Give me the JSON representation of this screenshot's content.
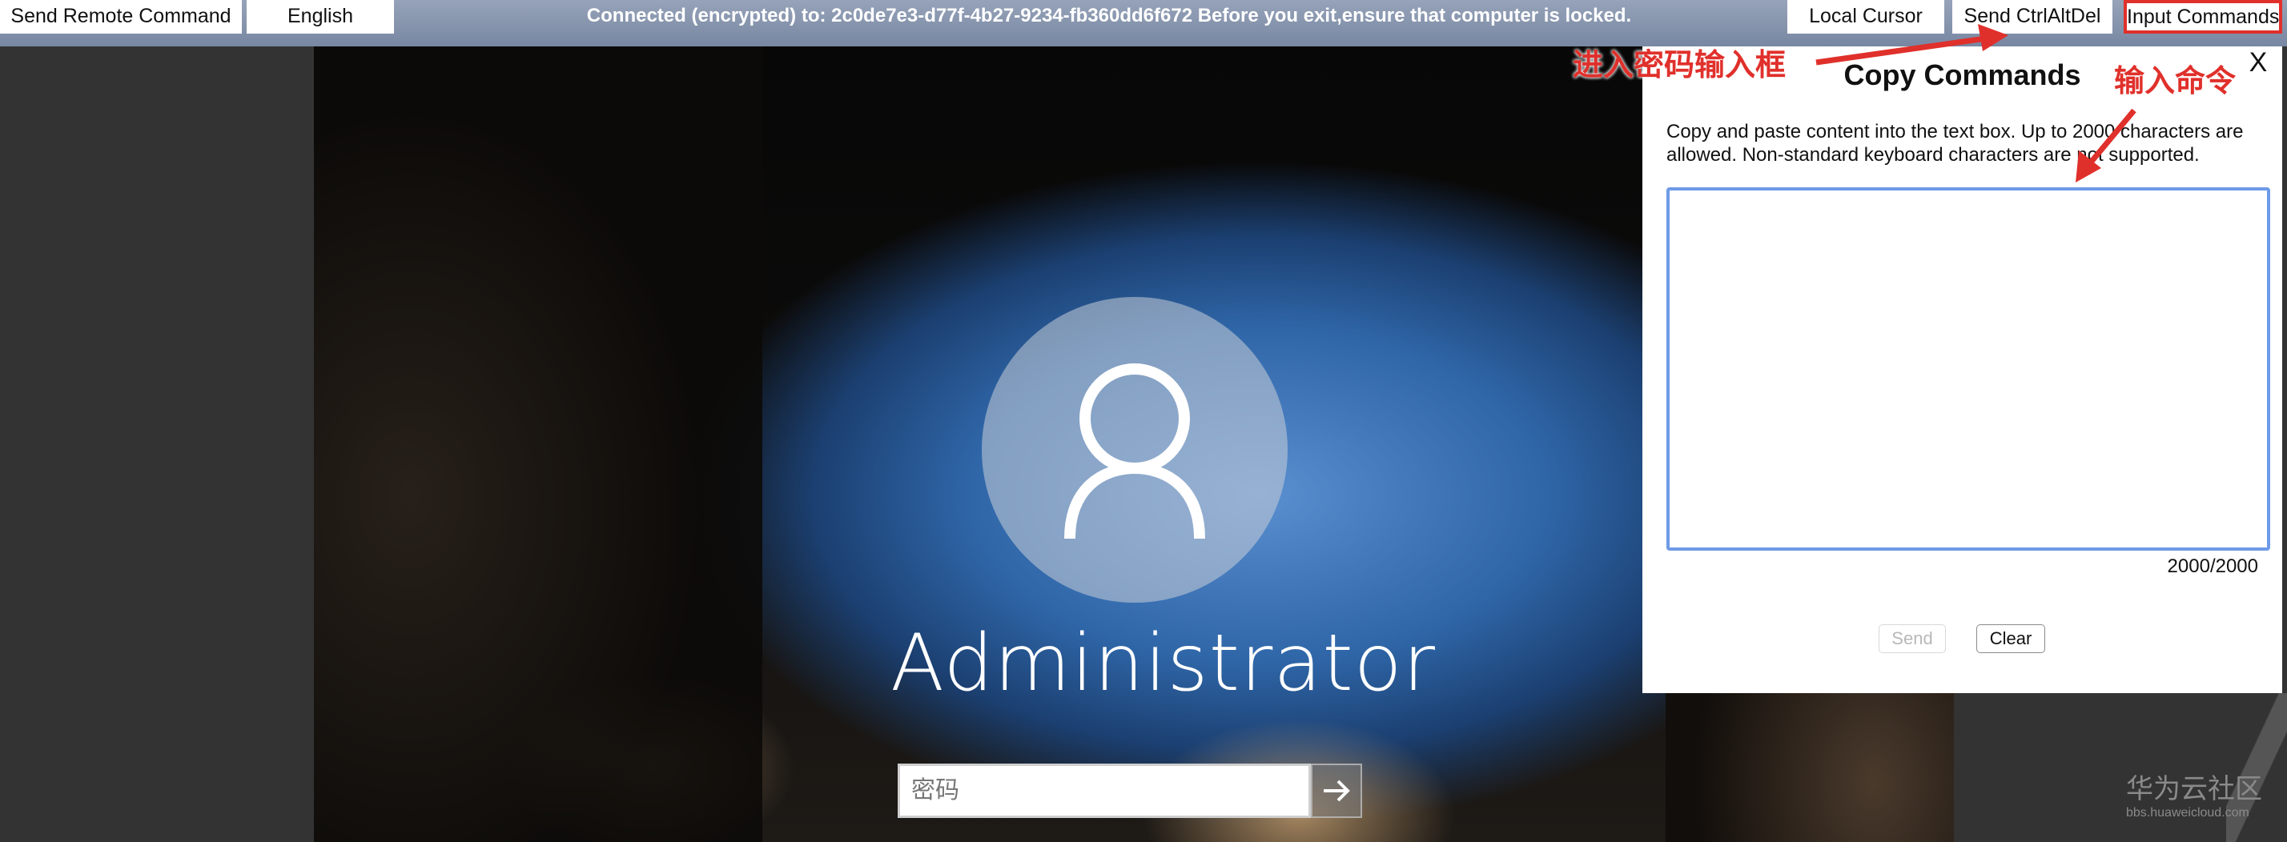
{
  "toolbar": {
    "send_remote_command": "Send Remote Command",
    "language": "English",
    "status": "Connected (encrypted) to: 2c0de7e3-d77f-4b27-9234-fb360dd6f672 Before you exit,ensure that computer is locked.",
    "local_cursor": "Local Cursor",
    "send_ctrl_alt_del": "Send CtrlAltDel",
    "input_commands": "Input Commands"
  },
  "login": {
    "username": "Administrator",
    "password_placeholder": "密码",
    "avatar_icon": "user-icon",
    "submit_icon": "arrow-right-icon"
  },
  "dialog": {
    "title": "Copy Commands",
    "close_label": "X",
    "description": "Copy and paste content into the text box. Up to 2000 characters are allowed. Non-standard keyboard characters are not supported.",
    "text_value": "",
    "counter": "2000/2000",
    "send_label": "Send",
    "clear_label": "Clear"
  },
  "annotations": {
    "enter_password_box": "进入密码输入框",
    "input_command": "输入命令",
    "color": "#e0302b"
  },
  "watermark": {
    "name": "华为云社区",
    "url": "bbs.huaweicloud.com"
  }
}
